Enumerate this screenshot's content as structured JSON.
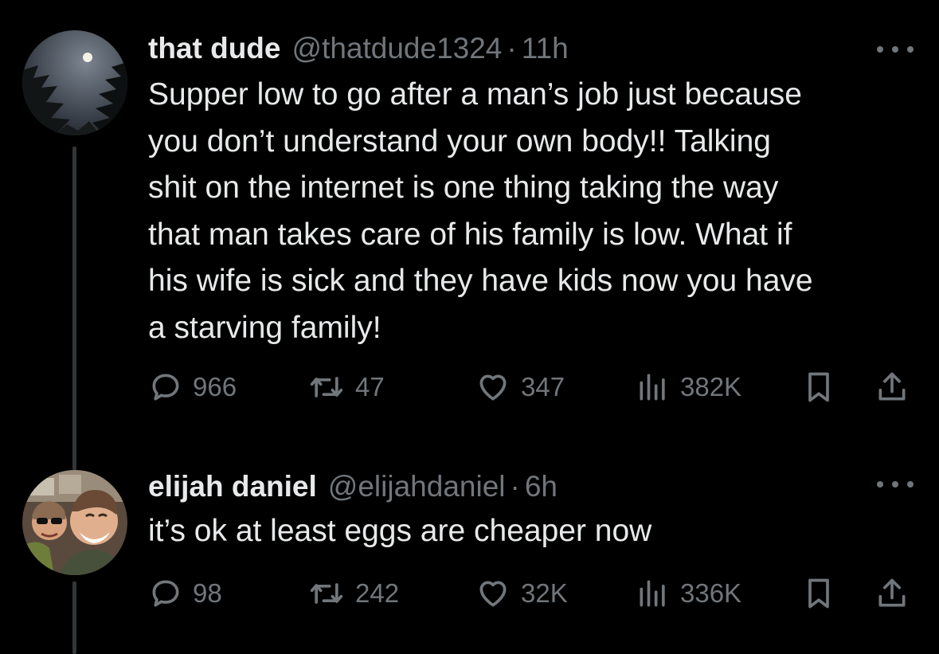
{
  "tweets": [
    {
      "name": "that dude",
      "handle": "@thatdude1324",
      "separator": "·",
      "time": "11h",
      "text": "Supper low to go after a man’s job just because\nyou don’t understand your own body!! Talking\nshit on the internet is one thing taking the way\nthat man takes care of his family is low. What if\nhis wife is sick and they have kids now you have\na starving family!",
      "replies": "966",
      "reposts": "47",
      "likes": "347",
      "views": "382K"
    },
    {
      "name": "elijah daniel",
      "handle": "@elijahdaniel",
      "separator": "·",
      "time": "6h",
      "text": "it’s ok at least eggs are cheaper now",
      "replies": "98",
      "reposts": "242",
      "likes": "32K",
      "views": "336K"
    }
  ],
  "icons": {
    "reply": "reply-icon",
    "repost": "repost-icon",
    "like": "heart-icon",
    "views": "views-icon",
    "bookmark": "bookmark-icon",
    "share": "share-icon",
    "more": "more-icon"
  },
  "colors": {
    "background": "#000000",
    "text": "#e7e9ea",
    "muted": "#71767b",
    "thread_line": "#333639"
  }
}
